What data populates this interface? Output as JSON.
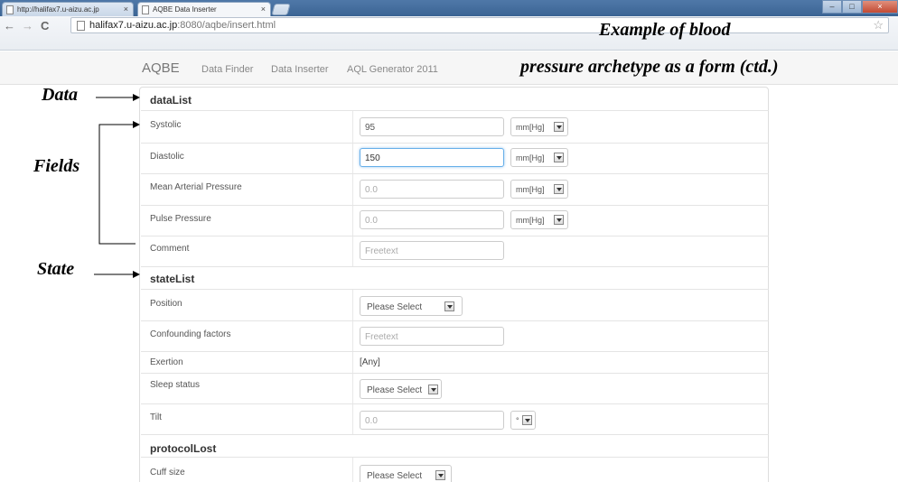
{
  "browser": {
    "tabs": [
      {
        "label": "http://halifax7.u-aizu.ac.jp"
      },
      {
        "label": "AQBE Data Inserter"
      }
    ],
    "url_host": "halifax7.u-aizu.ac.jp",
    "url_path": ":8080/aqbe/insert.html"
  },
  "navbar": {
    "brand": "AQBE",
    "links": [
      "Data Finder",
      "Data Inserter",
      "AQL Generator 2011"
    ]
  },
  "annotations": {
    "title_line1": "Example of blood",
    "title_line2": "pressure archetype as a form (ctd.)",
    "data": "Data",
    "fields": "Fields",
    "state": "State"
  },
  "form": {
    "data_section": "dataList",
    "systolic": {
      "label": "Systolic",
      "value": "95",
      "unit": "mm[Hg]"
    },
    "diastolic": {
      "label": "Diastolic",
      "value": "150",
      "unit": "mm[Hg]"
    },
    "map": {
      "label": "Mean Arterial Pressure",
      "placeholder": "0.0",
      "unit": "mm[Hg]"
    },
    "pulse": {
      "label": "Pulse Pressure",
      "placeholder": "0.0",
      "unit": "mm[Hg]"
    },
    "comment": {
      "label": "Comment",
      "placeholder": "Freetext"
    },
    "state_section": "stateList",
    "position": {
      "label": "Position",
      "value": "Please Select"
    },
    "confounding": {
      "label": "Confounding factors",
      "placeholder": "Freetext"
    },
    "exertion": {
      "label": "Exertion",
      "value": "[Any]"
    },
    "sleep": {
      "label": "Sleep status",
      "value": "Please Select"
    },
    "tilt": {
      "label": "Tilt",
      "placeholder": "0.0",
      "unit": "°"
    },
    "protocol_section": "protocolLost",
    "cuff": {
      "label": "Cuff size",
      "value": "Please Select"
    }
  }
}
